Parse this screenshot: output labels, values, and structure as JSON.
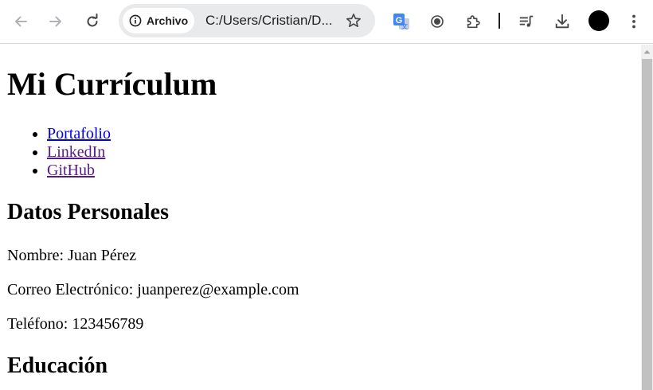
{
  "browser": {
    "nav": {
      "back_icon": "arrow-left-icon",
      "forward_icon": "arrow-right-icon",
      "reload_icon": "reload-icon"
    },
    "omnibox": {
      "chip_label": "Archivo",
      "chip_icon": "info-icon",
      "url": "C:/Users/Cristian/D...",
      "bookmark_icon": "star-icon"
    },
    "extensions": [
      "google-translate-icon",
      "record-icon",
      "extensions-puzzle-icon"
    ],
    "right_icons": [
      "media-queue-icon",
      "download-icon",
      "profile-avatar",
      "more-menu-icon"
    ]
  },
  "page": {
    "title": "Mi Currículum",
    "links": [
      {
        "label": "Portafolio",
        "state": "unvisited"
      },
      {
        "label": "LinkedIn",
        "state": "visited"
      },
      {
        "label": "GitHub",
        "state": "visited"
      }
    ],
    "personal": {
      "heading": "Datos Personales",
      "name": "Nombre: Juan Pérez",
      "email": "Correo Electrónico: juanperez@example.com",
      "phone": "Teléfono: 123456789"
    },
    "education": {
      "heading": "Educación"
    }
  },
  "colors": {
    "link_unvisited": "#0000ee",
    "link_visited": "#551a8b",
    "omnibox_bg": "#e9eaec",
    "scroll_thumb": "#c1c1c1"
  }
}
